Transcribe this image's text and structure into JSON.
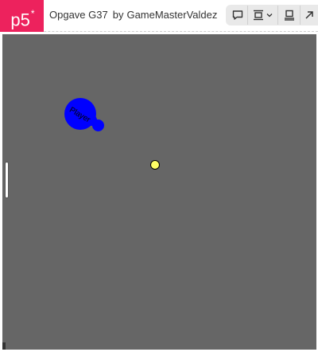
{
  "header": {
    "logo_text": "p5",
    "logo_mark": "*",
    "sketch_title": "Opgave G37",
    "by_label": "by",
    "author": "GameMasterValdez"
  },
  "toolbar": {
    "buttons": [
      {
        "icon": "comment-icon"
      },
      {
        "icon": "embed-size-icon"
      },
      {
        "icon": "display-icon"
      },
      {
        "icon": "open-external-icon"
      }
    ]
  },
  "game": {
    "background_color": "#666666",
    "player": {
      "label": "Player",
      "color": "#0000ff"
    },
    "ball": {
      "color": "#ffff66"
    }
  }
}
